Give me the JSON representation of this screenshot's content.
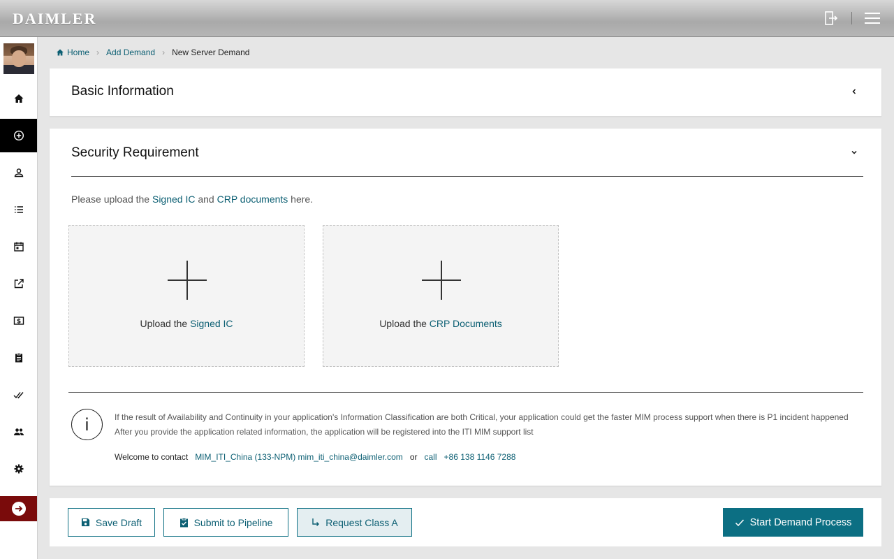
{
  "header": {
    "logo": "DAIMLER",
    "logout_icon": "logout-icon",
    "menu_icon": "hamburger-menu-icon"
  },
  "sidebar": {
    "items": [
      {
        "name": "home",
        "icon": "home-icon"
      },
      {
        "name": "add-demand",
        "icon": "add-circle-icon",
        "active": true
      },
      {
        "name": "profile",
        "icon": "person-icon"
      },
      {
        "name": "list",
        "icon": "list-icon"
      },
      {
        "name": "calendar",
        "icon": "calendar-icon"
      },
      {
        "name": "open-external",
        "icon": "external-link-icon"
      },
      {
        "name": "billing",
        "icon": "dollar-icon"
      },
      {
        "name": "assignment",
        "icon": "clipboard-icon"
      },
      {
        "name": "approvals",
        "icon": "double-check-icon"
      },
      {
        "name": "team",
        "icon": "people-icon"
      },
      {
        "name": "settings",
        "icon": "gear-icon"
      }
    ],
    "exit_icon": "arrow-right-icon"
  },
  "breadcrumb": {
    "home": "Home",
    "add": "Add Demand",
    "current": "New Server Demand"
  },
  "basic": {
    "title": "Basic Information"
  },
  "security": {
    "title": "Security Requirement",
    "intro_pre": "Please upload the ",
    "intro_link1": "Signed IC",
    "intro_mid": " and ",
    "intro_link2": "CRP documents",
    "intro_post": " here.",
    "upload1_pre": "Upload the ",
    "upload1_link": "Signed IC",
    "upload2_pre": "Upload the ",
    "upload2_link": "CRP Documents",
    "info_icon": "i",
    "info_line1": "If the result of Availability and Continuity in your application's Information Classification are both Critical, your application could get the faster MIM process support when there is P1 incident happened",
    "info_line2": "After you provide the application related information, the application will be registered into the ITI MIM support list",
    "contact_pre": "Welcome to contact",
    "contact_link": "MIM_ITI_China (133-NPM) mim_iti_china@daimler.com",
    "contact_or": "or",
    "contact_call": "call",
    "contact_phone": "+86 138 1146 7288"
  },
  "actions": {
    "save": "Save Draft",
    "submit": "Submit to Pipeline",
    "request": "Request Class A",
    "start": "Start Demand Process"
  },
  "colors": {
    "accent": "#0c6f83",
    "link": "#0c5f73",
    "exit": "#7a0b0b"
  }
}
